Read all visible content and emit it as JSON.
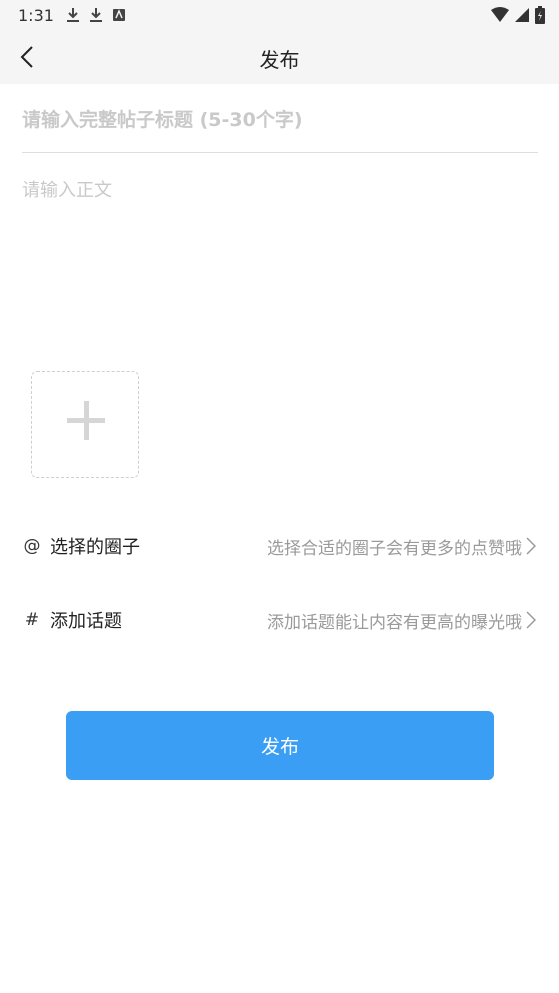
{
  "status_bar": {
    "time": "1:31"
  },
  "nav": {
    "title": "发布"
  },
  "form": {
    "title_placeholder": "请输入完整帖子标题 (5-30个字)",
    "body_placeholder": "请输入正文"
  },
  "rows": {
    "circle": {
      "icon": "@",
      "label": "选择的圈子",
      "hint": "选择合适的圈子会有更多的点赞哦"
    },
    "topic": {
      "icon": "#",
      "label": "添加话题",
      "hint": "添加话题能让内容有更高的曝光哦"
    }
  },
  "publish_button": {
    "label": "发布"
  },
  "colors": {
    "accent": "#3a9ef4",
    "bar_bg": "#f5f5f5"
  }
}
